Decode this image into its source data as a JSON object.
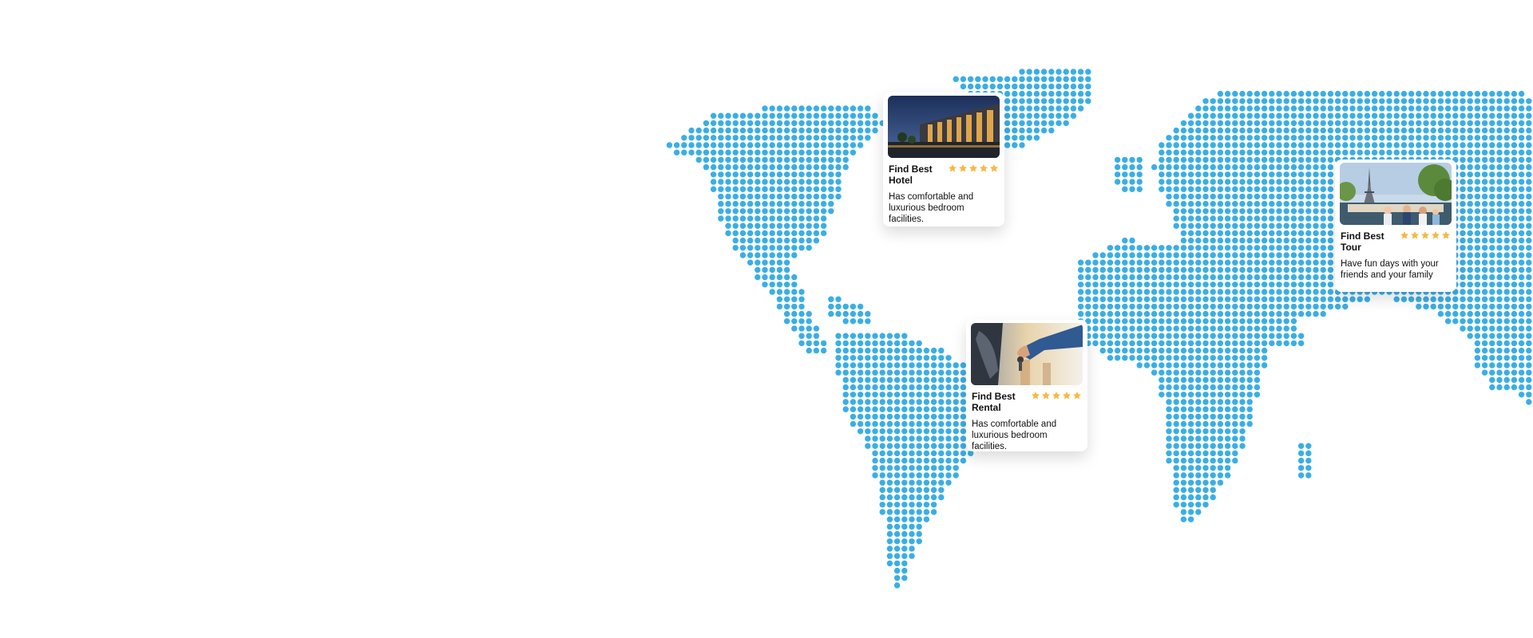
{
  "map": {
    "dot_color": "#3aaee6",
    "background": "#ffffff"
  },
  "cards": {
    "hotel": {
      "title": "Find Best Hotel",
      "description": "Has comfortable and luxurious bedroom facilities.",
      "rating": 5,
      "image": "hotel-photo"
    },
    "tour": {
      "title": "Find Best Tour",
      "description": "Have fun days with your friends and your family",
      "rating": 5,
      "image": "eiffel-tower-tour-photo"
    },
    "rental": {
      "title": "Find Best Rental",
      "description": "Has comfortable and luxurious bedroom facilities.",
      "rating": 5,
      "image": "car-key-rental-photo"
    }
  },
  "colors": {
    "star": "#f5b942",
    "text": "#111111"
  }
}
